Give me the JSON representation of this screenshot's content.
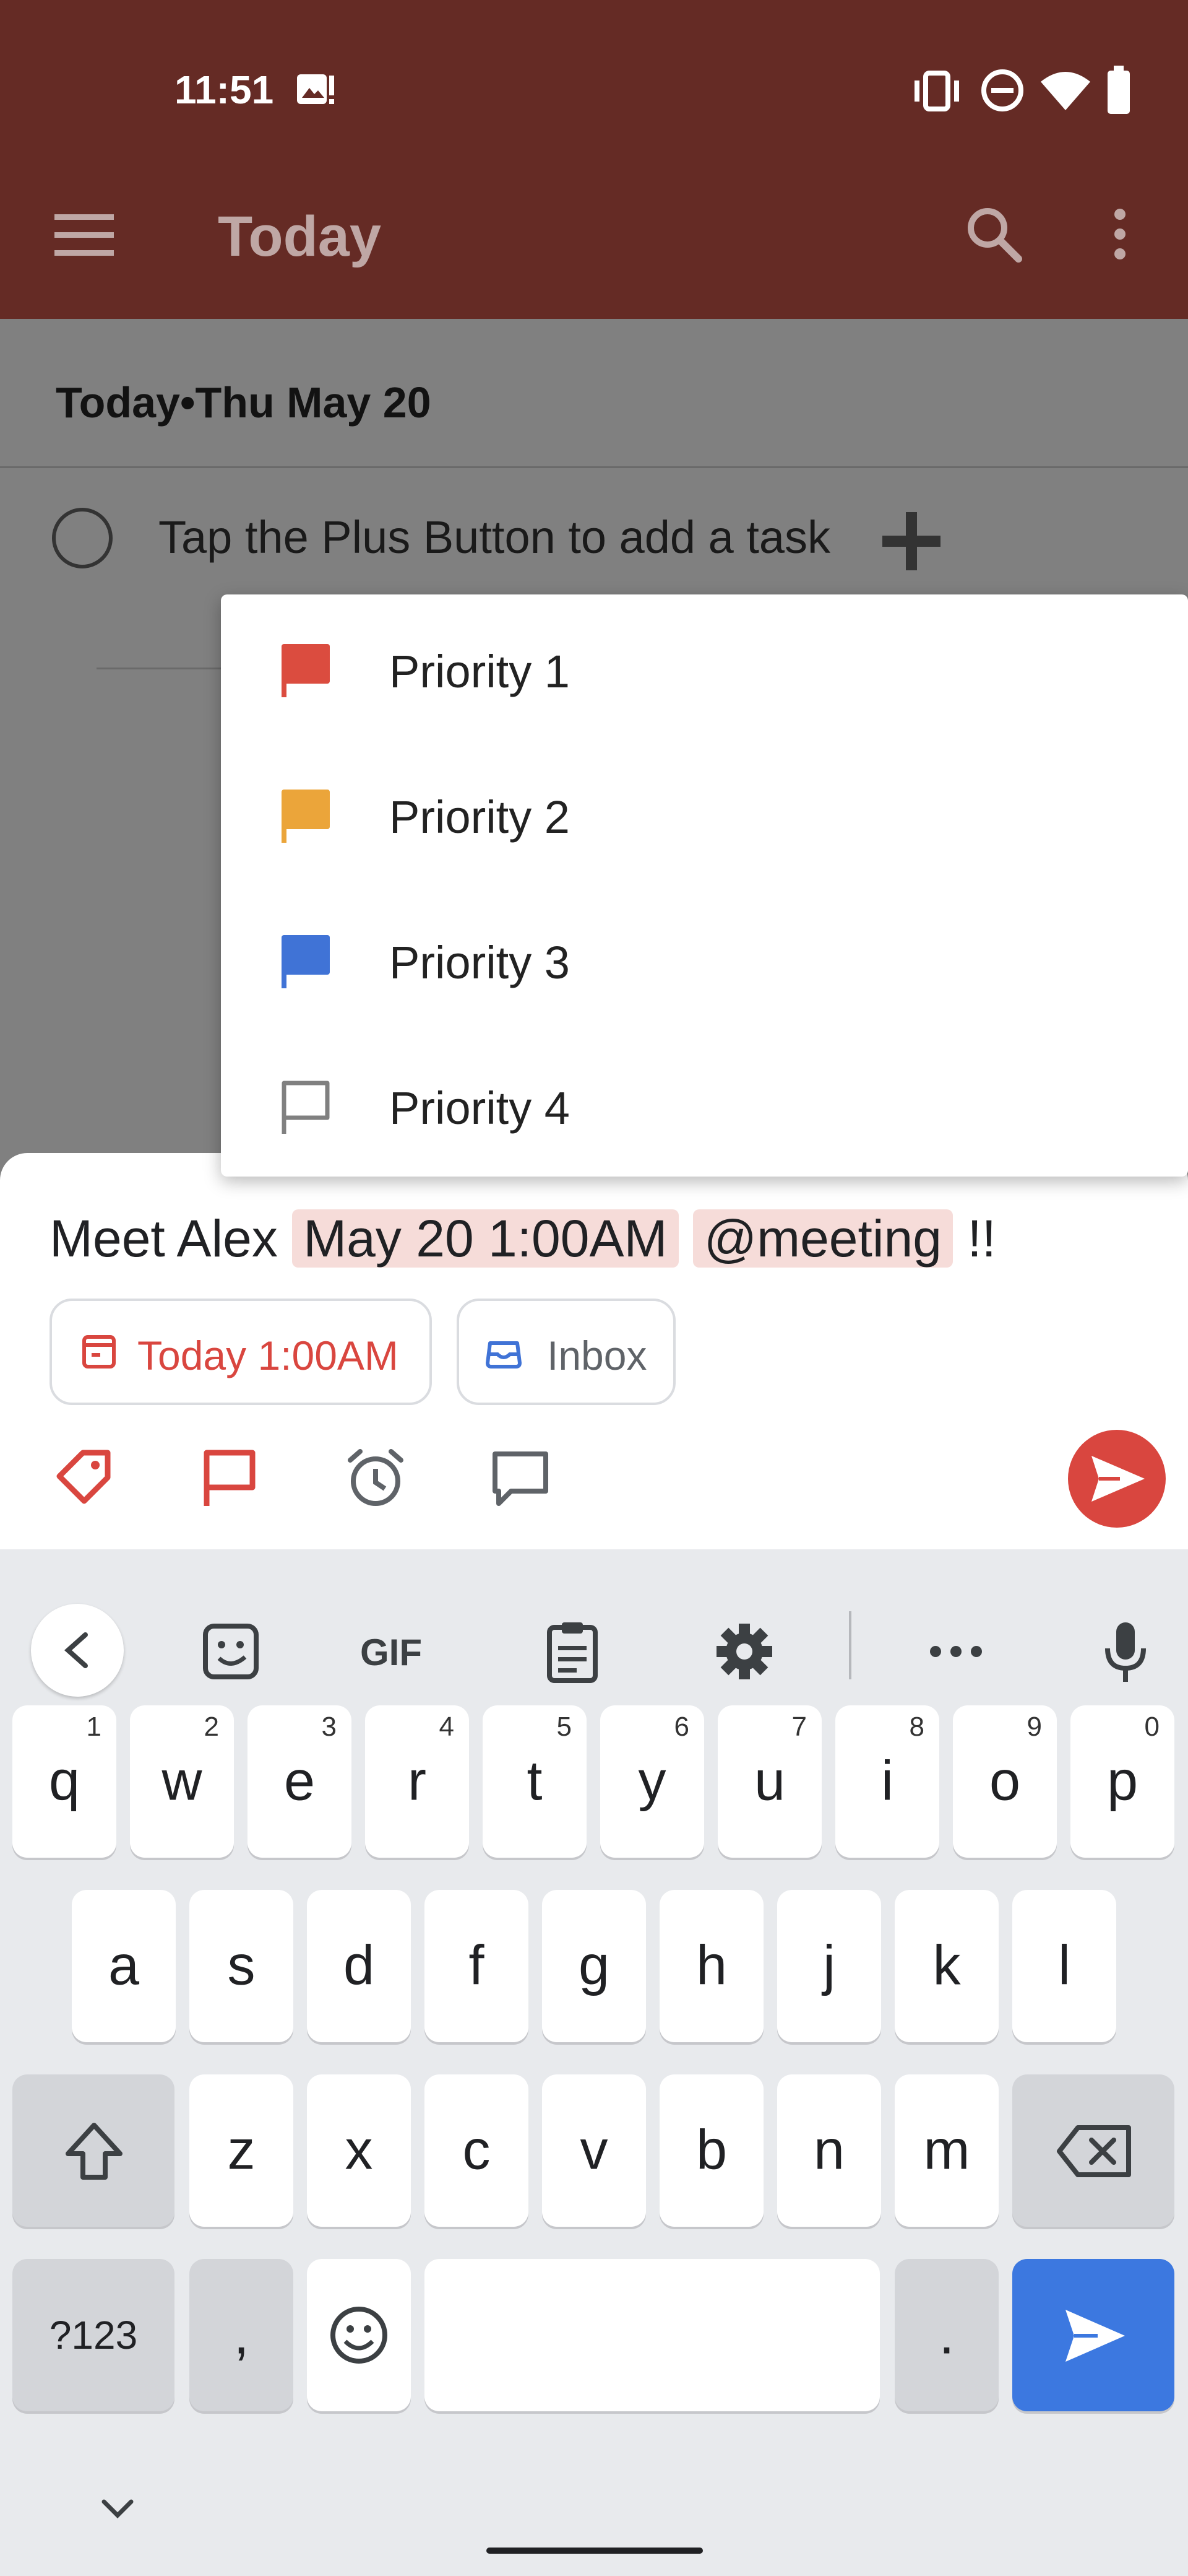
{
  "status_bar": {
    "time": "11:51"
  },
  "app_bar": {
    "title": "Today"
  },
  "content": {
    "date_header": "Today•Thu May 20",
    "empty_task": "Tap the Plus Button to add a task"
  },
  "priority_menu": {
    "items": [
      {
        "label": "Priority 1",
        "color": "#db4c3f"
      },
      {
        "label": "Priority 2",
        "color": "#eba53a"
      },
      {
        "label": "Priority 3",
        "color": "#4073d6"
      },
      {
        "label": "Priority 4",
        "color": "#808080"
      }
    ]
  },
  "quick_add": {
    "text_plain": "Meet Alex",
    "text_date": "May 20 1:00AM",
    "text_label": "@meeting",
    "text_priority": "!!",
    "due_chip": "Today 1:00AM",
    "project_chip": "Inbox"
  },
  "keyboard": {
    "tool_gif": "GIF",
    "row1": [
      {
        "k": "q",
        "h": "1"
      },
      {
        "k": "w",
        "h": "2"
      },
      {
        "k": "e",
        "h": "3"
      },
      {
        "k": "r",
        "h": "4"
      },
      {
        "k": "t",
        "h": "5"
      },
      {
        "k": "y",
        "h": "6"
      },
      {
        "k": "u",
        "h": "7"
      },
      {
        "k": "i",
        "h": "8"
      },
      {
        "k": "o",
        "h": "9"
      },
      {
        "k": "p",
        "h": "0"
      }
    ],
    "row2": [
      "a",
      "s",
      "d",
      "f",
      "g",
      "h",
      "j",
      "k",
      "l"
    ],
    "row3": [
      "z",
      "x",
      "c",
      "v",
      "b",
      "n",
      "m"
    ],
    "sym": "?123",
    "comma": ",",
    "period": "."
  },
  "colors": {
    "accent": "#d9463f",
    "appbar": "#652b25",
    "keyboard_action": "#3c78e0"
  }
}
